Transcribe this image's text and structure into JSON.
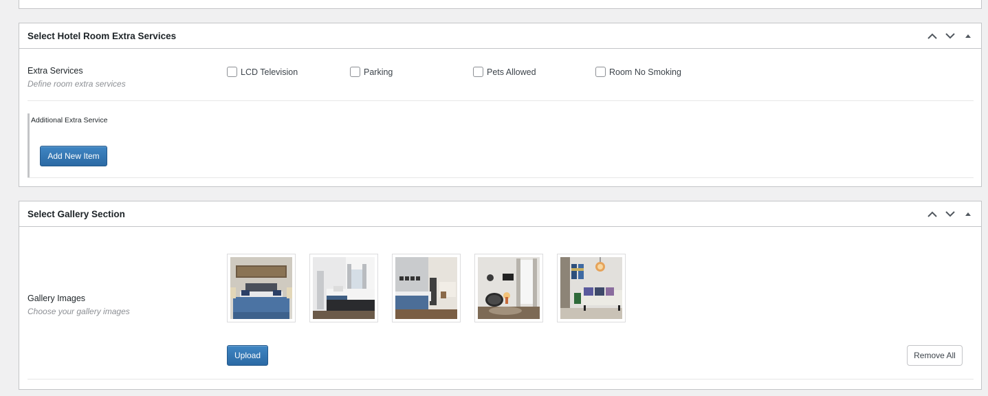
{
  "top_box": {},
  "extra_services_box": {
    "title": "Select Hotel Room Extra Services",
    "field_title": "Extra Services",
    "field_desc": "Define room extra services",
    "options": [
      {
        "label": "LCD Television",
        "checked": false
      },
      {
        "label": "Parking",
        "checked": false
      },
      {
        "label": "Pets Allowed",
        "checked": false
      },
      {
        "label": "Room No Smoking",
        "checked": false
      }
    ],
    "repeater_title": "Additional Extra Service",
    "add_button": "Add New Item"
  },
  "gallery_box": {
    "title": "Select Gallery Section",
    "field_title": "Gallery Images",
    "field_desc": "Choose your gallery images",
    "upload_button": "Upload",
    "remove_all_button": "Remove All"
  },
  "colors": {
    "primary_button": "#2b6aa4",
    "background": "#f0f0f1",
    "border": "#c3c4c7"
  },
  "icons": [
    "chevron-up-icon",
    "chevron-down-icon",
    "caret-up-icon"
  ]
}
